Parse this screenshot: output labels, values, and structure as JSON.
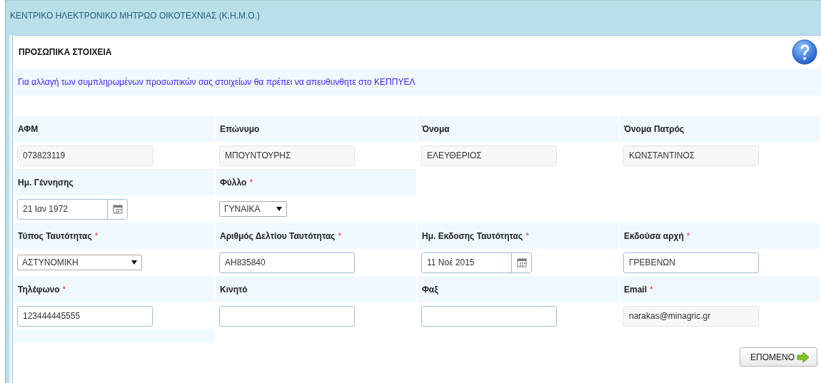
{
  "window": {
    "title": "ΚΕΝΤΡΙΚΟ ΗΛΕΚΤΡΟΝΙΚΟ ΜΗΤΡΩΟ ΟΙΚΟΤΕΧΝΙΑΣ (Κ.Η.Μ.Ο.)"
  },
  "section": {
    "title": "ΠΡΟΣΩΠΙΚΑ ΣΤΟΙΧΕΙΑ",
    "notice": "Για αλλαγή των συμπληρωμένων προσωπικών σας στοιχείων θα πρέπει να απευθυνθητε στο ΚΕΠΠΥΕΛ"
  },
  "rows": [
    {
      "fields": [
        {
          "label": "ΑΦΜ",
          "required": false,
          "kind": "readonly",
          "value": "073823119"
        },
        {
          "label": "Επώνυμο",
          "required": false,
          "kind": "readonly",
          "value": "ΜΠΟΥΝΤΟΥΡΗΣ"
        },
        {
          "label": "Όνομα",
          "required": false,
          "kind": "readonly",
          "value": "ΕΛΕΥΘΕΡΙΟΣ"
        },
        {
          "label": "Όνομα Πατρός",
          "required": false,
          "kind": "readonly",
          "value": "ΚΩΝΣΤΑΝΤΙΝΟΣ"
        }
      ]
    },
    {
      "fields": [
        {
          "label": "Ημ. Γέννησης",
          "required": false,
          "kind": "date",
          "value": "21 Ιαν 1972"
        },
        {
          "label": "Φύλλο",
          "required": true,
          "kind": "select-small",
          "value": "ΓΥΝΑΙΚΑ"
        }
      ]
    },
    {
      "fields": [
        {
          "label": "Τύπος Ταυτότητας",
          "required": true,
          "kind": "select",
          "value": "ΑΣΤΥΝΟΜΙΚΗ"
        },
        {
          "label": "Αριθμός Δελτίου Ταυτότητας",
          "required": true,
          "kind": "text",
          "value": "ΑΗ835840"
        },
        {
          "label": "Ημ. Εκδοσης Ταυτότητας",
          "required": true,
          "kind": "date",
          "value": "11 Νοέ 2015"
        },
        {
          "label": "Εκδούσα αρχή",
          "required": true,
          "kind": "text",
          "value": "ΓΡΕΒΕΝΩΝ"
        }
      ]
    },
    {
      "fields": [
        {
          "label": "Τηλέφωνο",
          "required": true,
          "kind": "text",
          "value": "123444445555"
        },
        {
          "label": "Κινητό",
          "required": false,
          "kind": "text"
        },
        {
          "label": "Φαξ",
          "required": false,
          "kind": "text"
        },
        {
          "label": "Email",
          "required": true,
          "kind": "readonly",
          "value": "narakas@minagric.gr"
        }
      ]
    }
  ],
  "required_mark": "*",
  "next_button": {
    "label": "ΕΠΟΜΕΝΟ"
  }
}
